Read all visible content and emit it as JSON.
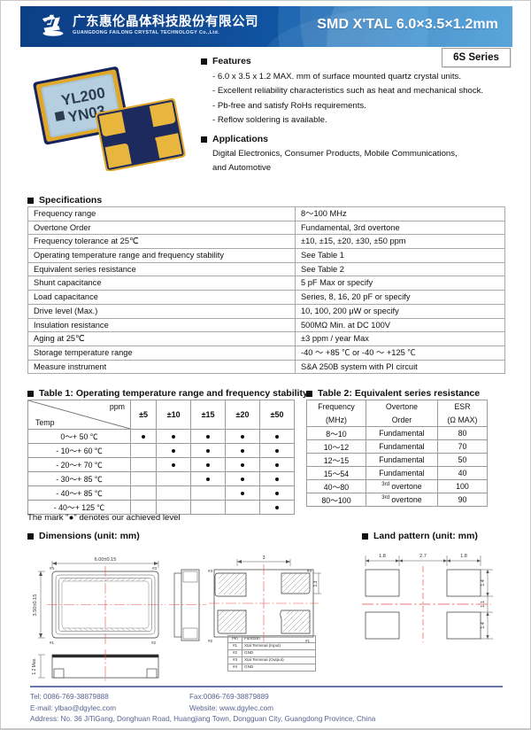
{
  "header": {
    "company_cn": "广东惠伦晶体科技股份有限公司",
    "company_en": "GUANGDONG FAILONG CRYSTAL TECHNOLOGY Co.,Ltd.",
    "title": "SMD X'TAL 6.0×3.5×1.2mm",
    "accent_dark": "#0b3f86",
    "accent_light": "#1e86cd"
  },
  "series_badge": "6S Series",
  "product_photo": {
    "top_marking_line1": "YL200",
    "top_marking_line2": "YN03",
    "lid_color": "#a8c4d8",
    "frame_color": "#e0a829",
    "body_color": "#1d2a5e",
    "pad_color": "#e8b63c"
  },
  "features": {
    "heading": "Features",
    "items": [
      "- 6.0 x 3.5 x 1.2 MAX. mm of surface mounted quartz crystal units.",
      "- Excellent reliability characteristics such as heat and mechanical shock.",
      "- Pb-free and satisfy RoHs requirements.",
      "- Reflow soldering is available."
    ]
  },
  "applications": {
    "heading": "Applications",
    "lines": [
      "Digital Electronics, Consumer Products, Mobile Communications,",
      "and Automotive"
    ]
  },
  "specifications": {
    "heading": "Specifications",
    "rows": [
      {
        "key": "Frequency range",
        "value": "8～100 MHz"
      },
      {
        "key": "Overtone Order",
        "value": "Fundamental, 3rd overtone"
      },
      {
        "key": "Frequency tolerance at 25℃",
        "value": "±10, ±15, ±20, ±30, ±50 ppm"
      },
      {
        "key": "Operating temperature range and frequency stability",
        "value": "See Table 1"
      },
      {
        "key": "Equivalent series resistance",
        "value": "See Table 2"
      },
      {
        "key": "Shunt capacitance",
        "value": "5 pF Max or specify"
      },
      {
        "key": "Load capacitance",
        "value": "Series, 8, 16, 20 pF or specify"
      },
      {
        "key": "Drive level (Max.)",
        "value": "10, 100, 200 μW or specify"
      },
      {
        "key": "Insulation resistance",
        "value": "500MΩ Min. at DC 100V"
      },
      {
        "key": "Aging at 25℃",
        "value": "±3 ppm / year Max"
      },
      {
        "key": "Storage temperature range",
        "value": "-40 ～ +85 ℃ or -40 ～ +125 ℃"
      },
      {
        "key": "Measure instrument",
        "value": "S&A 250B system with PI circuit"
      }
    ]
  },
  "table1": {
    "heading": "Table 1: Operating temperature range and frequency stability",
    "corner_ppm": "ppm",
    "corner_temp": "Temp",
    "columns": [
      "±5",
      "±10",
      "±15",
      "±20",
      "±50"
    ],
    "rows": [
      {
        "temp": "0～+ 50 ℃",
        "marks": [
          true,
          true,
          true,
          true,
          true
        ]
      },
      {
        "temp": "- 10～+ 60 ℃",
        "marks": [
          false,
          true,
          true,
          true,
          true
        ]
      },
      {
        "temp": "- 20～+ 70 ℃",
        "marks": [
          false,
          true,
          true,
          true,
          true
        ]
      },
      {
        "temp": "- 30～+ 85 ℃",
        "marks": [
          false,
          false,
          true,
          true,
          true
        ]
      },
      {
        "temp": "- 40～+ 85 ℃",
        "marks": [
          false,
          false,
          false,
          true,
          true
        ]
      },
      {
        "temp": "- 40～+ 125 ℃",
        "marks": [
          false,
          false,
          false,
          false,
          true
        ]
      }
    ],
    "note": "The mark \"●\" denotes our achieved level"
  },
  "table2": {
    "heading": "Table 2: Equivalent series resistance",
    "header": {
      "c1a": "Frequency",
      "c1b": "(MHz)",
      "c2a": "Overtone",
      "c2b": "Order",
      "c3a": "ESR",
      "c3b": "(Ω MAX)"
    },
    "rows": [
      {
        "freq": "8～10",
        "order": "Fundamental",
        "order_sup": "",
        "esr": "80"
      },
      {
        "freq": "10～12",
        "order": "Fundamental",
        "order_sup": "",
        "esr": "70"
      },
      {
        "freq": "12～15",
        "order": "Fundamental",
        "order_sup": "",
        "esr": "50"
      },
      {
        "freq": "15～54",
        "order": "Fundamental",
        "order_sup": "",
        "esr": "40"
      },
      {
        "freq": "40～80",
        "order": "overtone",
        "order_sup": "3rd",
        "esr": "100"
      },
      {
        "freq": "80～100",
        "order": "overtone",
        "order_sup": "3rd",
        "esr": "90"
      }
    ]
  },
  "dimensions": {
    "heading": "Dimensions (unit: mm)",
    "length": "6.00±0.15",
    "width": "3.50±0.15",
    "height": "1.2 Max.",
    "pad_pitch": "3",
    "pad_width": "1.3",
    "pin_labels": [
      "#1",
      "#2",
      "#3",
      "#4"
    ]
  },
  "land_pattern": {
    "heading": "Land pattern (unit: mm)",
    "h_dims": [
      "1.8",
      "2.7",
      "1.8"
    ],
    "v_dims": [
      "1.4",
      "1.1",
      "1.4"
    ]
  },
  "pin_table": {
    "col_pin": "Pin",
    "col_function": "Function",
    "rows": [
      {
        "pin": "#1",
        "function": "Xtal Terminal (Input)"
      },
      {
        "pin": "#2",
        "function": "GND"
      },
      {
        "pin": "#3",
        "function": "Xtal Terminal (Output)"
      },
      {
        "pin": "#4",
        "function": "GND"
      }
    ]
  },
  "footer": {
    "tel": "Tel: 0086-769-38879888",
    "fax": "Fax:0086-769-38879889",
    "email": "E-mail: ylbao@dgylec.com",
    "website": "Website: www.dgylec.com",
    "address": "Address: No. 36 JiTiGang, Donghuan Road, Huangjiang Town, Dongguan City, Guangdong Province, China"
  }
}
